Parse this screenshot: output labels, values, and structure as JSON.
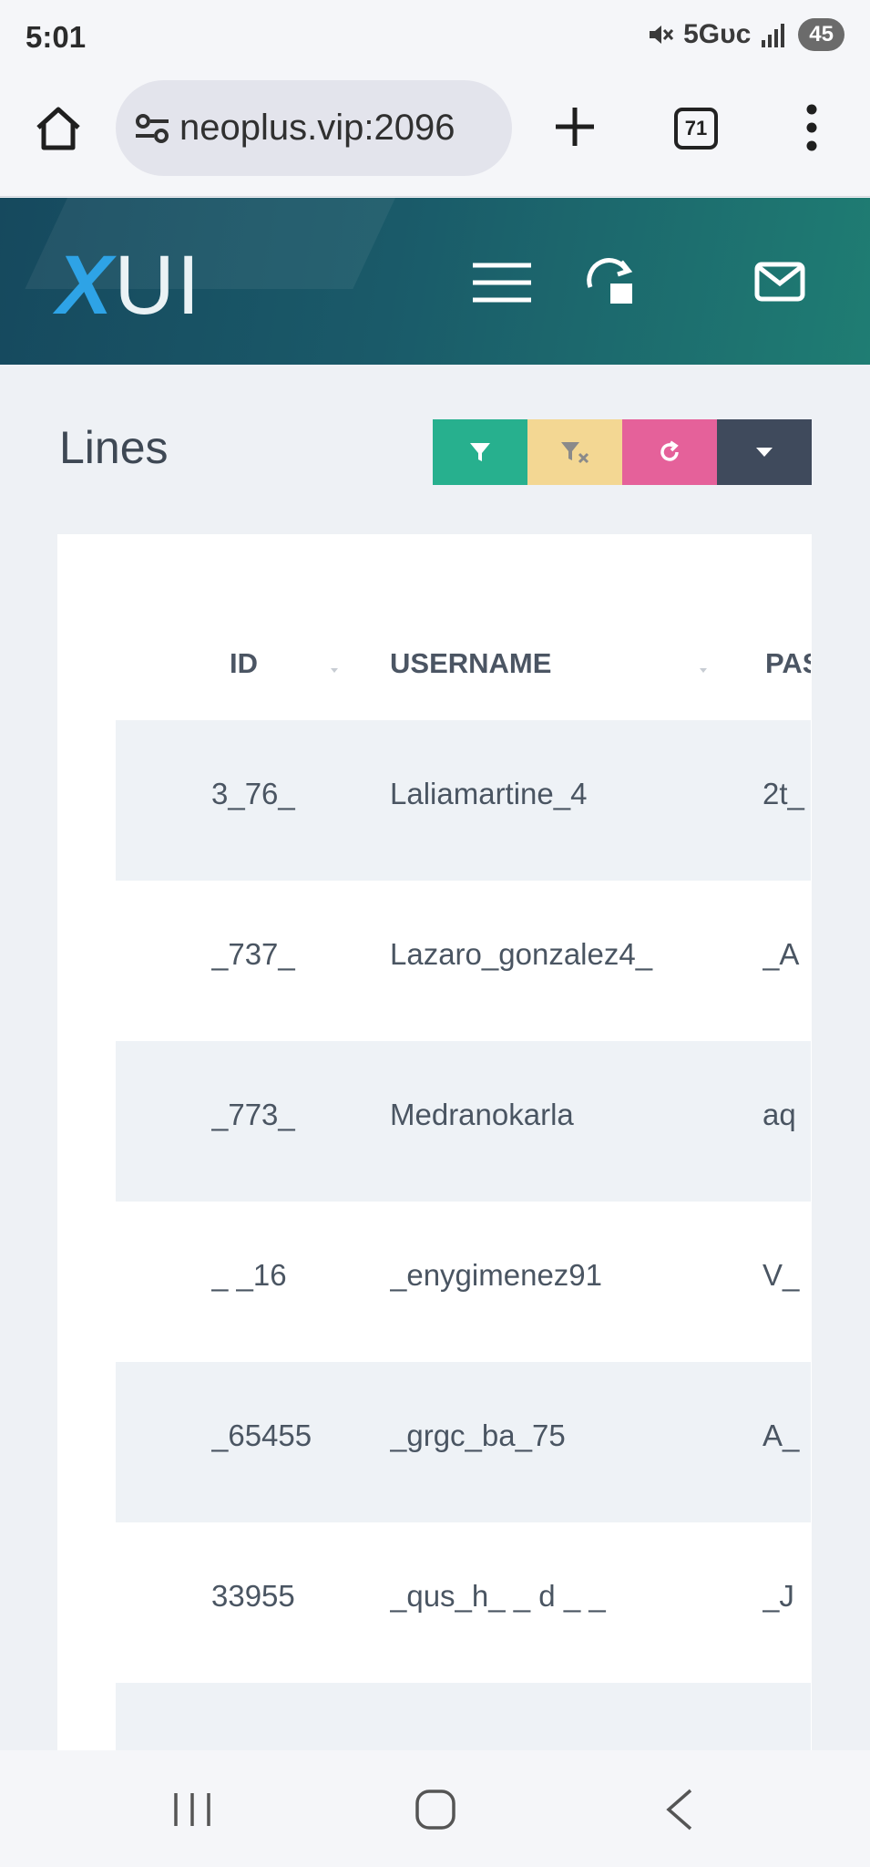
{
  "status_bar": {
    "time": "5:01",
    "network": "5Gᴜᴄ",
    "battery": "45"
  },
  "browser": {
    "url": "neoplus.vip:2096",
    "tab_count": "71"
  },
  "header": {
    "logo_x": "X",
    "logo_ui": "UI"
  },
  "page": {
    "title": "Lines"
  },
  "table": {
    "headers": {
      "id": "ID",
      "username": "USERNAME",
      "password": "PAS"
    },
    "rows": [
      {
        "id": "3_76_",
        "username": "Laliamartine_4",
        "password": "2t_"
      },
      {
        "id": "_737_",
        "username": "Lazaro_gonzalez4_",
        "password": "_A"
      },
      {
        "id": "_773_",
        "username": "Medranokarla",
        "password": "aq"
      },
      {
        "id": "_ _16",
        "username": "_enygimenez91",
        "password": "V_"
      },
      {
        "id": "_65455",
        "username": "_grgc_ba_75",
        "password": "A_"
      },
      {
        "id": "33955",
        "username": "_qus_h_ _ d _ _",
        "password": "_J"
      },
      {
        "id": "",
        "username": "",
        "password": ""
      }
    ]
  },
  "colors": {
    "header_start": "#16495e",
    "header_end": "#1f7d73",
    "filter_btn": "#27b08e",
    "clear_btn": "#f3d793",
    "refresh_btn": "#e5619a",
    "dropdown_btn": "#3f4a5c"
  }
}
